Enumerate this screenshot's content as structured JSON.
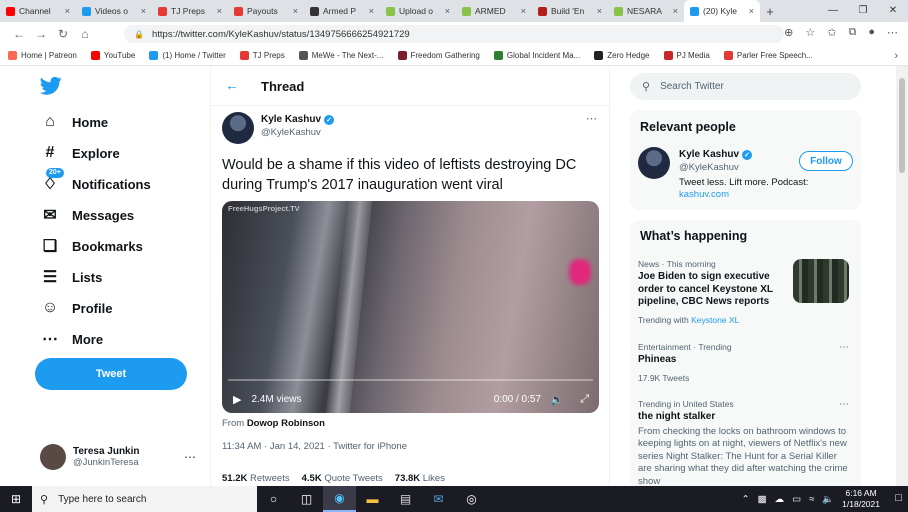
{
  "browser": {
    "tabs": [
      {
        "label": "Channel",
        "color": "#ff0000"
      },
      {
        "label": "Videos o",
        "color": "#1d9bf0"
      },
      {
        "label": "TJ Preps",
        "color": "#e53935"
      },
      {
        "label": "Payouts",
        "color": "#e53935"
      },
      {
        "label": "Armed P",
        "color": "#333333"
      },
      {
        "label": "Upload o",
        "color": "#8bc34a"
      },
      {
        "label": "ARMED",
        "color": "#8bc34a"
      },
      {
        "label": "Build 'En",
        "color": "#b71c1c"
      },
      {
        "label": "NESARA",
        "color": "#8bc34a"
      },
      {
        "label": "(20) Kyle",
        "color": "#1d9bf0"
      }
    ],
    "url": "https://twitter.com/KyleKashuv/status/1349756666254921729",
    "bookmarks": [
      {
        "label": "Home | Patreon",
        "color": "#f96854"
      },
      {
        "label": "YouTube",
        "color": "#ff0000"
      },
      {
        "label": "(1) Home / Twitter",
        "color": "#1d9bf0"
      },
      {
        "label": "TJ Preps",
        "color": "#e53935"
      },
      {
        "label": "MeWe - The Next-...",
        "color": "#555555"
      },
      {
        "label": "Freedom Gathering",
        "color": "#7b1f2e"
      },
      {
        "label": "Global Incident Ma...",
        "color": "#2e7d32"
      },
      {
        "label": "Zero Hedge",
        "color": "#222222"
      },
      {
        "label": "PJ Media",
        "color": "#c62828"
      },
      {
        "label": "Parler Free Speech...",
        "color": "#e53935"
      }
    ]
  },
  "twitter": {
    "nav": {
      "home": "Home",
      "explore": "Explore",
      "notifications": "Notifications",
      "notif_badge": "20+",
      "messages": "Messages",
      "bookmarks": "Bookmarks",
      "lists": "Lists",
      "profile": "Profile",
      "more": "More",
      "tweet_button": "Tweet"
    },
    "current_user": {
      "name": "Teresa Junkin",
      "handle": "@JunkinTeresa"
    },
    "thread": {
      "title": "Thread",
      "author_name": "Kyle Kashuv",
      "author_handle": "@KyleKashuv",
      "text": "Would be a shame if this video of leftists destroying DC during Trump's 2017 inauguration went viral",
      "video": {
        "watermark": "FreeHugsProject.TV",
        "views": "2.4M views",
        "time": "0:00 / 0:57",
        "progress": 0
      },
      "from_label": "From",
      "from_name": "Dowop Robinson",
      "meta": "11:34 AM · Jan 14, 2021 · Twitter for iPhone",
      "retweets_count": "51.2K",
      "retweets_label": "Retweets",
      "quotes_count": "4.5K",
      "quotes_label": "Quote Tweets",
      "likes_count": "73.8K",
      "likes_label": "Likes"
    },
    "search_placeholder": "Search Twitter",
    "relevant": {
      "title": "Relevant people",
      "name": "Kyle Kashuv",
      "handle": "@KyleKashuv",
      "follow": "Follow",
      "bio": "Tweet less. Lift more. Podcast:",
      "bio_link": "kashuv.com"
    },
    "happening": {
      "title": "What’s happening",
      "trends": [
        {
          "context": "News · This morning",
          "title": "Joe Biden to sign executive order to cancel Keystone XL pipeline, CBC News reports",
          "sub_prefix": "Trending with",
          "sub_link": "Keystone XL"
        },
        {
          "context": "Entertainment · Trending",
          "title": "Phineas",
          "sub": "17.9K Tweets"
        },
        {
          "context": "Trending in United States",
          "title": "the night stalker",
          "desc": "From checking the locks on bathroom windows to keeping lights on at night, viewers of Netflix's new series Night Stalker: The Hunt for a Serial Killer are sharing what they did after watching the crime show"
        }
      ]
    }
  },
  "taskbar": {
    "search_placeholder": "Type here to search",
    "time": "6:16 AM",
    "date": "1/18/2021"
  }
}
